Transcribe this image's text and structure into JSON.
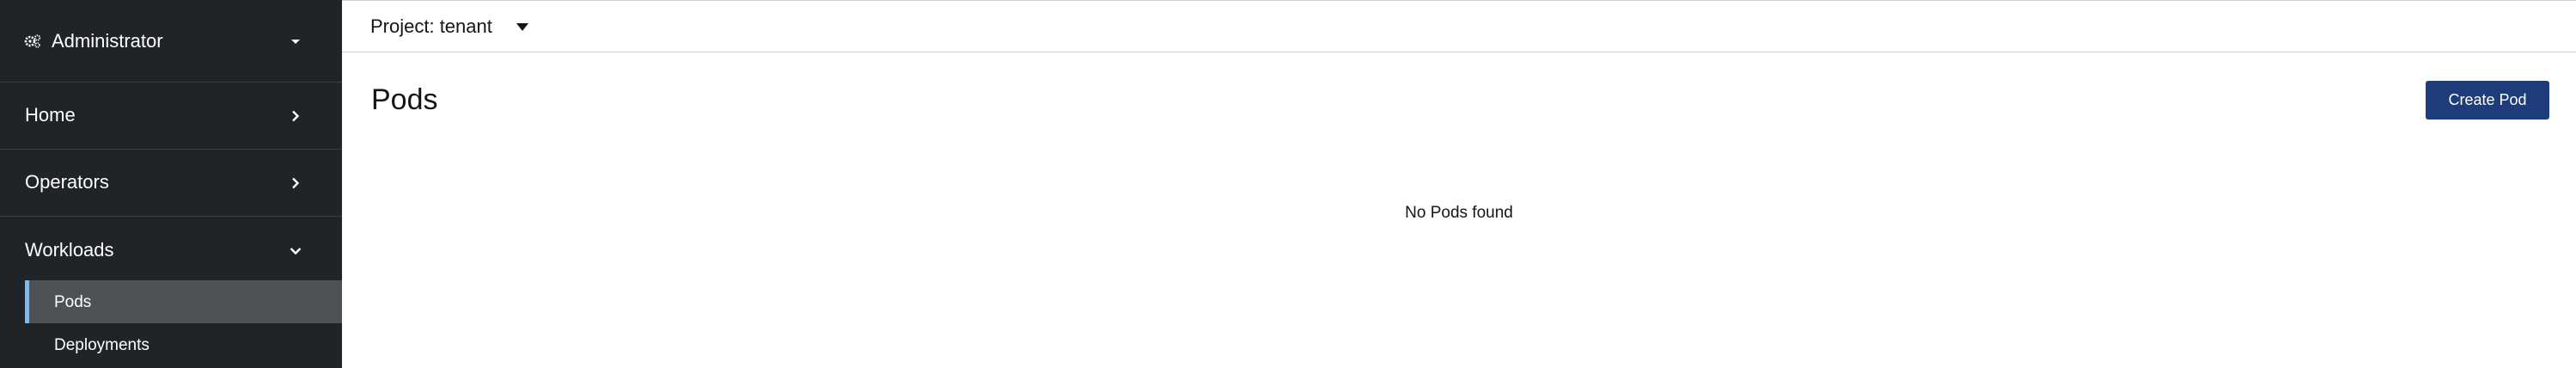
{
  "sidebar": {
    "perspective": {
      "label": "Administrator",
      "icon": "gears-icon",
      "chevron": "chevron-down-icon"
    },
    "sections": [
      {
        "label": "Home",
        "chevron": "chevron-right-icon"
      },
      {
        "label": "Operators",
        "chevron": "chevron-right-icon"
      },
      {
        "label": "Workloads",
        "chevron": "chevron-down-icon",
        "items": [
          {
            "label": "Pods",
            "active": true
          },
          {
            "label": "Deployments",
            "active": false
          }
        ]
      }
    ]
  },
  "project": {
    "label": "Project: tenant"
  },
  "page": {
    "title": "Pods",
    "create_button": "Create Pod",
    "empty_message": "No Pods found"
  },
  "colors": {
    "sidebar_bg": "#212427",
    "active_item_bg": "#4f5255",
    "active_indicator": "#73bcf7",
    "primary_button": "#1f3c7a"
  }
}
